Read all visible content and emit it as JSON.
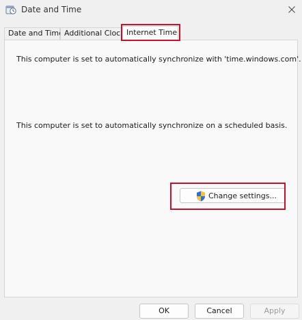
{
  "window": {
    "title": "Date and Time",
    "icon": "date-time-icon"
  },
  "tabs": [
    {
      "label": "Date and Time",
      "selected": false
    },
    {
      "label": "Additional Clocks",
      "selected": false
    },
    {
      "label": "Internet Time",
      "selected": true
    }
  ],
  "panel": {
    "sync_server_text": "This computer is set to automatically synchronize with 'time.windows.com'.",
    "sync_schedule_text": "This computer is set to automatically synchronize on a scheduled basis.",
    "change_settings_label": "Change settings..."
  },
  "footer": {
    "ok_label": "OK",
    "cancel_label": "Cancel",
    "apply_label": "Apply"
  },
  "colors": {
    "highlight": "#c8102e",
    "window_bg": "#f0f0f0"
  }
}
